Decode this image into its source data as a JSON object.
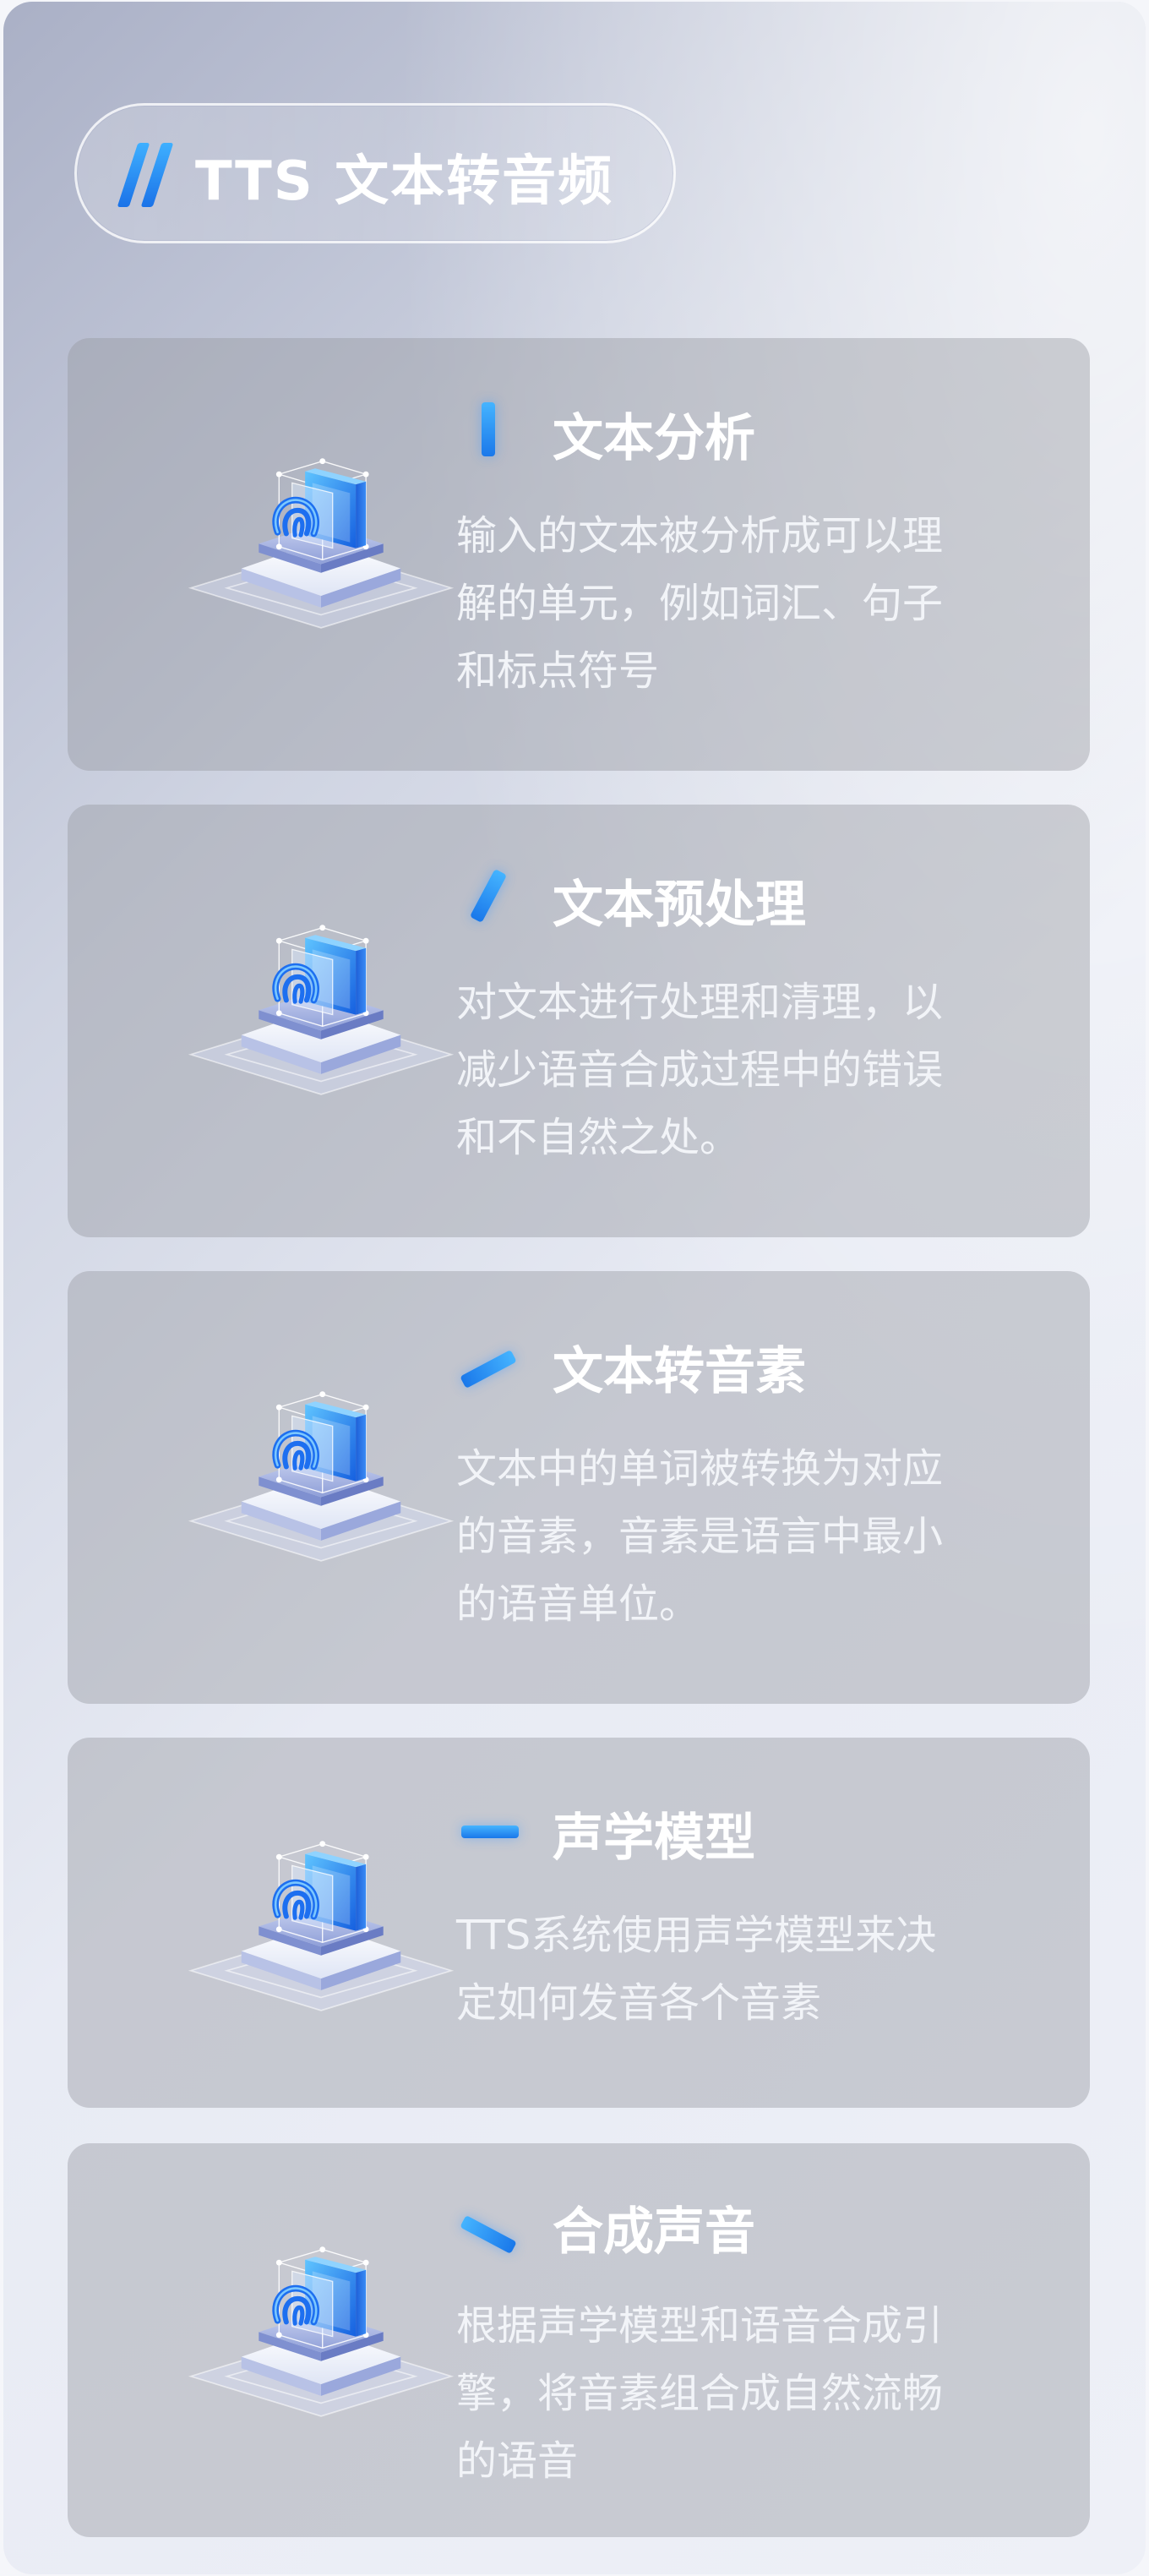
{
  "title": "TTS 文本转音频",
  "colors": {
    "accent": "#2d8ff2",
    "card_bg": "#9a9ca4",
    "text": "#ffffff"
  },
  "cards": [
    {
      "heading": "文本分析",
      "icon": "tts-module-icon",
      "lines": [
        "输入的文本被分析成可以理",
        "解的单元，例如词汇、句子",
        "和标点符号"
      ]
    },
    {
      "heading": "文本预处理",
      "icon": "tts-module-icon",
      "lines": [
        "对文本进行处理和清理，以",
        "减少语音合成过程中的错误",
        "和不自然之处。"
      ]
    },
    {
      "heading": "文本转音素",
      "icon": "tts-module-icon",
      "lines": [
        "文本中的单词被转换为对应",
        "的音素，音素是语言中最小",
        "的语音单位。"
      ]
    },
    {
      "heading": "声学模型",
      "icon": "tts-module-icon",
      "lines": [
        "TTS系统使用声学模型来决",
        "定如何发音各个音素"
      ]
    },
    {
      "heading": "合成声音",
      "icon": "tts-module-icon",
      "lines": [
        "根据声学模型和语音合成引",
        "擎，将音素组合成自然流畅",
        "的语音"
      ]
    }
  ]
}
